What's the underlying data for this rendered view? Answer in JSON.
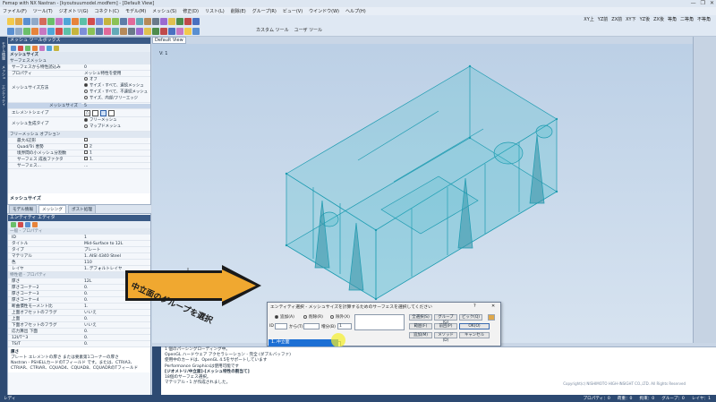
{
  "window": {
    "title": "Femap with NX Nastran - [kyoutsuumodel.modfem] - [Default View]",
    "controls": [
      "—",
      "❐",
      "✕"
    ]
  },
  "menu": [
    "ファイル(F)",
    "ツール(T)",
    "ジオメトリ(G)",
    "コネクト(C)",
    "モデル(M)",
    "メッシュ(S)",
    "修正(D)",
    "リスト(L)",
    "削除(E)",
    "グループ(R)",
    "ビュー(V)",
    "ウインドウ(W)",
    "ヘルプ(H)"
  ],
  "toolbar": {
    "right_row1": [
      "XY上",
      "YZ前",
      "ZX前",
      "XY下",
      "YZ後",
      "ZX後",
      "等角",
      "二等角",
      "不等角"
    ],
    "right_row2": [
      "カスタム ツール",
      "ユーザ ツール"
    ]
  },
  "left_strip": [
    "モデル情報",
    "メッシュ",
    "エンティティ"
  ],
  "toolbox": {
    "title": "メッシュ ツールボックス",
    "section_header": "メッシュサイズ",
    "sub_header": "サーフェスメッシュ",
    "rows": [
      {
        "k": "サーフェスから特性読込み",
        "v": "0"
      },
      {
        "k": "プロパティ",
        "v": "メッシュ特性を使用"
      }
    ],
    "sizing_label": "メッシュサイズ方法",
    "sizing_options": [
      "オフ",
      "サイズ・すべて、連続メッシュ",
      "サイズ・すべて、不連続メッシュ",
      "サイズ、内部/フリーエッジ"
    ],
    "size_label": "メッシュサイズ",
    "size_value": "5",
    "element_shape_label": "エレメントシェイプ",
    "mesher_label": "メッシュ生成タイプ",
    "mesher_options": [
      "フリーメッシュ",
      "マップドメッシュ"
    ],
    "free_options_header": "フリーメッシュ オプション",
    "free_rows": [
      {
        "k": "最大4辺形",
        "v": ""
      },
      {
        "k": "Quad/Tri 悪勢",
        "v": "2"
      },
      {
        "k": "境界間の小メッシュ分割数",
        "v": "1"
      },
      {
        "k": "サーフェス 成長ファクタ",
        "v": "1."
      },
      {
        "k": "サーフェス...",
        "v": "..."
      }
    ],
    "footer_label": "メッシュサイズ"
  },
  "tabs": [
    "モデル情報",
    "メッシング",
    "ポスト処理"
  ],
  "entity_editor": {
    "title": "エンティティ エディタ",
    "group1": "一般 - プロパティ",
    "rows1": [
      {
        "k": "ID",
        "v": "1"
      },
      {
        "k": "タイトル",
        "v": "Mid-Surface to 12L"
      },
      {
        "k": "タイプ",
        "v": "プレート"
      },
      {
        "k": "マテリアル",
        "v": "1..AISI 4340 Steel"
      },
      {
        "k": "色",
        "v": "110"
      },
      {
        "k": "レイヤ",
        "v": "1..デフォルトレイヤ"
      }
    ],
    "group2": "特性値 - プロパティ",
    "rows2": [
      {
        "k": "厚さ",
        "v": "12L"
      },
      {
        "k": "厚さコーナー2",
        "v": "0."
      },
      {
        "k": "厚さコーナー3",
        "v": "0."
      },
      {
        "k": "厚さコーナー4",
        "v": "0."
      },
      {
        "k": "断曲慣性モーメント比",
        "v": "1."
      },
      {
        "k": "上面オフセットのフラグ",
        "v": "いいえ"
      },
      {
        "k": "上面",
        "v": "0."
      },
      {
        "k": "下面オフセットのフラグ",
        "v": "いいえ"
      },
      {
        "k": "応力算出 下面",
        "v": "0."
      },
      {
        "k": "12I/T^3",
        "v": "0."
      },
      {
        "k": "TS/T",
        "v": "0."
      }
    ],
    "desc_title": "厚さ",
    "desc_text": "プレート エレメントの厚さ または要素第1コーナーの厚さ",
    "desc_text2": "Nastran - PSHELLカードのTフィールド です。または、CTRIA3、CTRIAR、CTRIAR、CQUAD4、CQUAD8、CQUADRのTフィールド"
  },
  "viewport": {
    "tab": "Default View",
    "label": "V: 1"
  },
  "dialog": {
    "title": "エンティティ選択 - メッシュサイズを計算するためのサーフェスを選択してください",
    "help": "?",
    "close": "✕",
    "radios": [
      "追加(A)",
      "削除(R)",
      "除外(X)"
    ],
    "id_label": "ID",
    "from_label": "から(T)",
    "inc_label": "増分(B)",
    "inc_value": "1",
    "buttons_col1": [
      "全選択(S)",
      "範囲(F)",
      "追加(M)"
    ],
    "buttons_col2": [
      "グループ(G)",
      "前回(P)",
      "メソッド(D)"
    ],
    "buttons_col3": [
      "ピック(Q)",
      "OK(O)",
      "キャンセル"
    ],
    "dropdown_selected": "1..中立面"
  },
  "banner_text": "中立面のグループを選択",
  "messages": [
    {
      "text": "1 個のパーシングローディング中。",
      "bold": false
    },
    {
      "text": "OpenGL ハードウェア アクセラレーション - 完全 (ダブルバッファ)",
      "bold": false
    },
    {
      "text": "使用中のカードは、OpenGL 4.5をサポートしています",
      "bold": false
    },
    {
      "text": "Performance Graphicsは使用可能です",
      "bold": false
    },
    {
      "text": "[ジオメトリ/中立面]-[メッシュ特性の割当て]",
      "bold": true
    },
    {
      "text": "18個のサーフェス選択。",
      "bold": false
    },
    {
      "text": "マテリアル・1 が作成されました。",
      "bold": false
    }
  ],
  "copyright": "Copyright(c) NISHIMOTO HIGH-INSIGHT CO.,LTD. All Rights Reserved",
  "status": {
    "left": "レディ",
    "right": [
      "プロパティ：0",
      "荷重：0",
      "拘束：0",
      "グループ：0",
      "レイヤ：1"
    ]
  }
}
